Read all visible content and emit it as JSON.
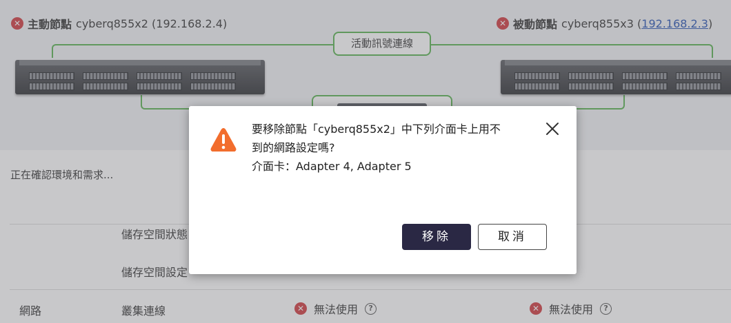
{
  "primary_node": {
    "role": "主動節點",
    "name": "cyberq855x2",
    "ip": "(192.168.2.4)"
  },
  "passive_node": {
    "role": "被動節點",
    "name": "cyberq855x3",
    "ip_open": "(",
    "ip": "192.168.2.3",
    "ip_close": ")"
  },
  "heartbeat_label": "活動訊號連線",
  "status_text": "正在確認環境和需求...",
  "rows": {
    "storage_status": "儲存空間狀態",
    "storage_settings": "儲存空間設定",
    "network_category": "網路",
    "cluster_link": "叢集連線",
    "primary_status": "無法使用",
    "passive_status": "無法使用"
  },
  "dialog": {
    "message_line1": "要移除節點「cyberq855x2」中下列介面卡上用不",
    "message_line2": "到的網路設定嗎?",
    "adapters": "介面卡：Adapter 4, Adapter 5",
    "remove_label": "移除",
    "cancel_label": "取消"
  },
  "icons": {
    "error": "x-circle-icon",
    "warning": "warning-icon",
    "help": "help-circle-icon",
    "close": "close-icon"
  },
  "colors": {
    "accent_green": "#58b24f",
    "error_red": "#d0393e",
    "warning_orange": "#f26d2d",
    "primary_button": "#2a2844"
  }
}
